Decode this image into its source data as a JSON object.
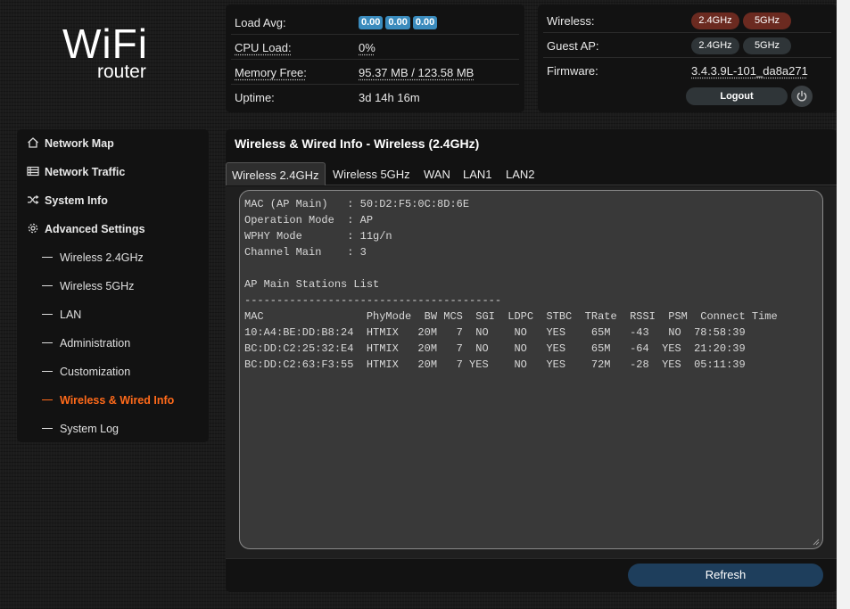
{
  "logo": {
    "wifi": "WiFi",
    "router": "router"
  },
  "status_left": {
    "load_avg_label": "Load Avg:",
    "load_avg_values": [
      "0.00",
      "0.00",
      "0.00"
    ],
    "cpu_label": "CPU Load:",
    "cpu_value": "0%",
    "mem_label": "Memory Free:",
    "mem_value": "95.37 MB / 123.58 MB",
    "uptime_label": "Uptime:",
    "uptime_value": "3d 14h 16m"
  },
  "status_right": {
    "wireless_label": "Wireless:",
    "wireless_bands": [
      {
        "label": "2.4GHz",
        "state": "active"
      },
      {
        "label": "5GHz",
        "state": "active"
      }
    ],
    "guest_label": "Guest AP:",
    "guest_bands": [
      {
        "label": "2.4GHz",
        "state": "inactive"
      },
      {
        "label": "5GHz",
        "state": "inactive"
      }
    ],
    "firmware_label": "Firmware:",
    "firmware_value": "3.4.3.9L-101_da8a271",
    "logout_label": "Logout",
    "power_icon": "power-icon"
  },
  "sidebar": {
    "items": [
      {
        "label": "Network Map",
        "icon": "home-icon"
      },
      {
        "label": "Network Traffic",
        "icon": "list-icon"
      },
      {
        "label": "System Info",
        "icon": "shuffle-icon"
      },
      {
        "label": "Advanced Settings",
        "icon": "gear-icon"
      }
    ],
    "sub_items": [
      {
        "label": "Wireless 2.4GHz",
        "active": false
      },
      {
        "label": "Wireless 5GHz",
        "active": false
      },
      {
        "label": "LAN",
        "active": false
      },
      {
        "label": "Administration",
        "active": false
      },
      {
        "label": "Customization",
        "active": false
      },
      {
        "label": "Wireless & Wired Info",
        "active": true
      },
      {
        "label": "System Log",
        "active": false
      }
    ],
    "active_color": "#ff6a1a"
  },
  "main": {
    "title": "Wireless & Wired Info - Wireless (2.4GHz)",
    "tabs": [
      {
        "label": "Wireless 2.4GHz",
        "active": true
      },
      {
        "label": "Wireless 5GHz",
        "active": false
      },
      {
        "label": "WAN",
        "active": false
      },
      {
        "label": "LAN1",
        "active": false
      },
      {
        "label": "LAN2",
        "active": false
      }
    ],
    "info_lines": [
      "MAC (AP Main)   : 50:D2:F5:0C:8D:6E",
      "Operation Mode  : AP",
      "WPHY Mode       : 11g/n",
      "Channel Main    : 3",
      "",
      "AP Main Stations List",
      "----------------------------------------",
      "MAC                PhyMode  BW MCS  SGI  LDPC  STBC  TRate  RSSI  PSM  Connect Time",
      "10:A4:BE:DD:B8:24  HTMIX   20M   7  NO    NO   YES    65M   -43   NO  78:58:39",
      "BC:DD:C2:25:32:E4  HTMIX   20M   7  NO    NO   YES    65M   -64  YES  21:20:39",
      "BC:DD:C2:63:F3:55  HTMIX   20M   7 YES    NO   YES    72M   -28  YES  05:11:39"
    ],
    "refresh_label": "Refresh"
  }
}
